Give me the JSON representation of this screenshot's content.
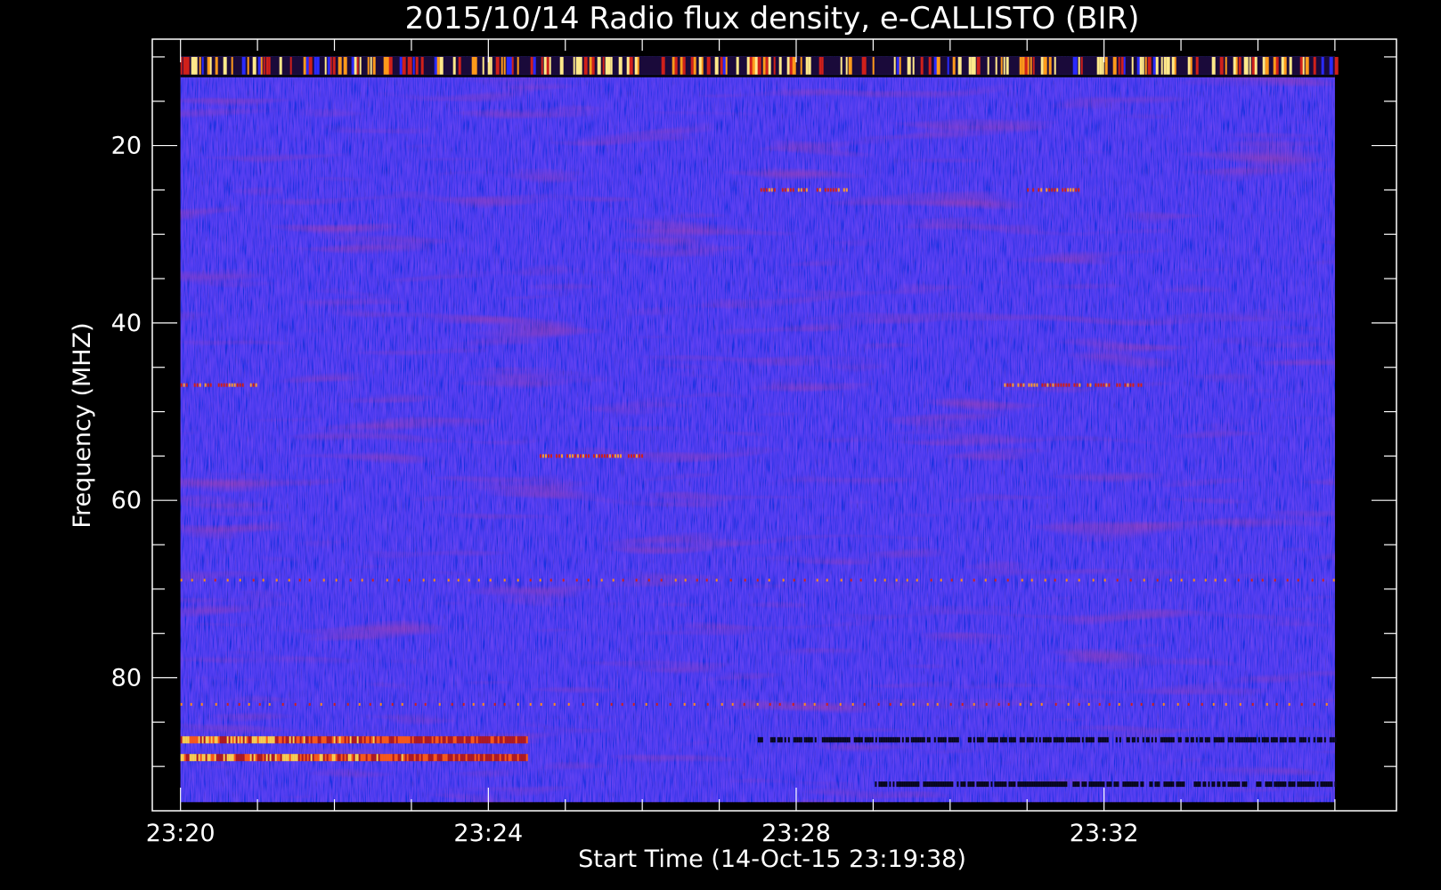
{
  "chart_data": {
    "type": "heatmap",
    "title": "2015/10/14  Radio flux density, e-CALLISTO (BIR)",
    "xlabel": "Start Time (14-Oct-15 23:19:38)",
    "ylabel": "Frequency (MHZ)",
    "x_ticks": [
      "23:20",
      "23:24",
      "23:28",
      "23:32"
    ],
    "y_ticks": [
      20,
      40,
      60,
      80
    ],
    "x_range": [
      "23:19:38",
      "23:35:48"
    ],
    "ylim": [
      95,
      8
    ],
    "data_x_range": [
      "23:20:00",
      "23:35:00"
    ],
    "data_y_range": [
      10,
      94
    ],
    "colormap": [
      "#000000",
      "#2a1f9e",
      "#3a2ad8",
      "#2f2fff",
      "#7a1a7a",
      "#c4221a",
      "#ff6a00",
      "#ffd400",
      "#ffffff"
    ],
    "background_color": "#3a3ae0",
    "features": [
      {
        "kind": "saturated-band",
        "freq_range": [
          10,
          12
        ],
        "note": "intermittent bright interference"
      },
      {
        "kind": "bright-band",
        "freq": 87,
        "time_range": [
          "23:20:00",
          "23:24:30"
        ]
      },
      {
        "kind": "bright-band",
        "freq": 89,
        "time_range": [
          "23:20:00",
          "23:24:30"
        ]
      },
      {
        "kind": "dark-band",
        "freq": 87,
        "time_range": [
          "23:27:30",
          "23:35:00"
        ]
      },
      {
        "kind": "dark-band",
        "freq": 92,
        "time_range": [
          "23:29:00",
          "23:35:00"
        ]
      },
      {
        "kind": "red-dotted-line",
        "freq": 83
      },
      {
        "kind": "red-dotted-line",
        "freq": 69
      },
      {
        "kind": "red-segment",
        "freq": 47,
        "time_range": [
          "23:20:00",
          "23:21:00"
        ]
      },
      {
        "kind": "red-segment",
        "freq": 47,
        "time_range": [
          "23:30:40",
          "23:32:30"
        ]
      },
      {
        "kind": "red-segment",
        "freq": 55,
        "time_range": [
          "23:24:40",
          "23:26:00"
        ]
      },
      {
        "kind": "red-segment",
        "freq": 25,
        "time_range": [
          "23:27:30",
          "23:28:40"
        ]
      },
      {
        "kind": "red-segment",
        "freq": 25,
        "time_range": [
          "23:31:00",
          "23:31:40"
        ]
      }
    ]
  }
}
